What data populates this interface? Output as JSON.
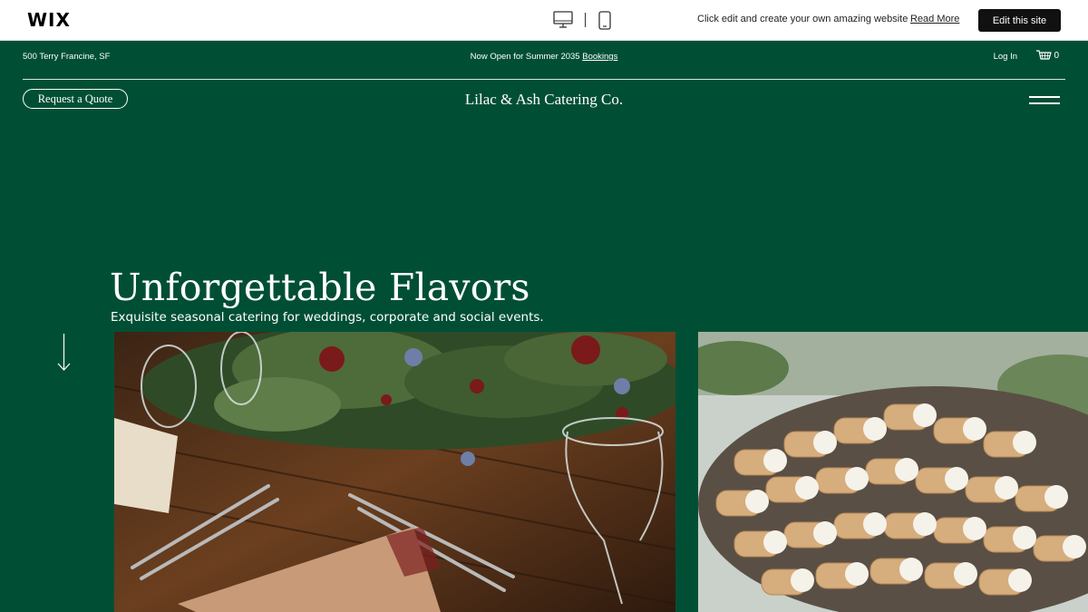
{
  "wix_bar": {
    "logo": "WIX",
    "promo": "Click edit and create your own amazing website",
    "read_more": "Read More",
    "edit_button": "Edit this site",
    "icons": [
      "desktop-icon",
      "mobile-icon"
    ]
  },
  "header": {
    "address": "500 Terry Francine, SF",
    "announcement_text": "Now Open for Summer 2035 ",
    "announcement_link": "Bookings",
    "login": "Log In",
    "cart_count": "0",
    "quote_button": "Request a Quote",
    "brand": "Lilac & Ash Catering Co."
  },
  "hero": {
    "title": "Unforgettable Flavors",
    "subtitle": "Exquisite seasonal catering for weddings, corporate and social events."
  },
  "colors": {
    "brand_green": "#004f35",
    "wix_bar_bg": "#ffffff",
    "edit_button_bg": "#111111"
  }
}
